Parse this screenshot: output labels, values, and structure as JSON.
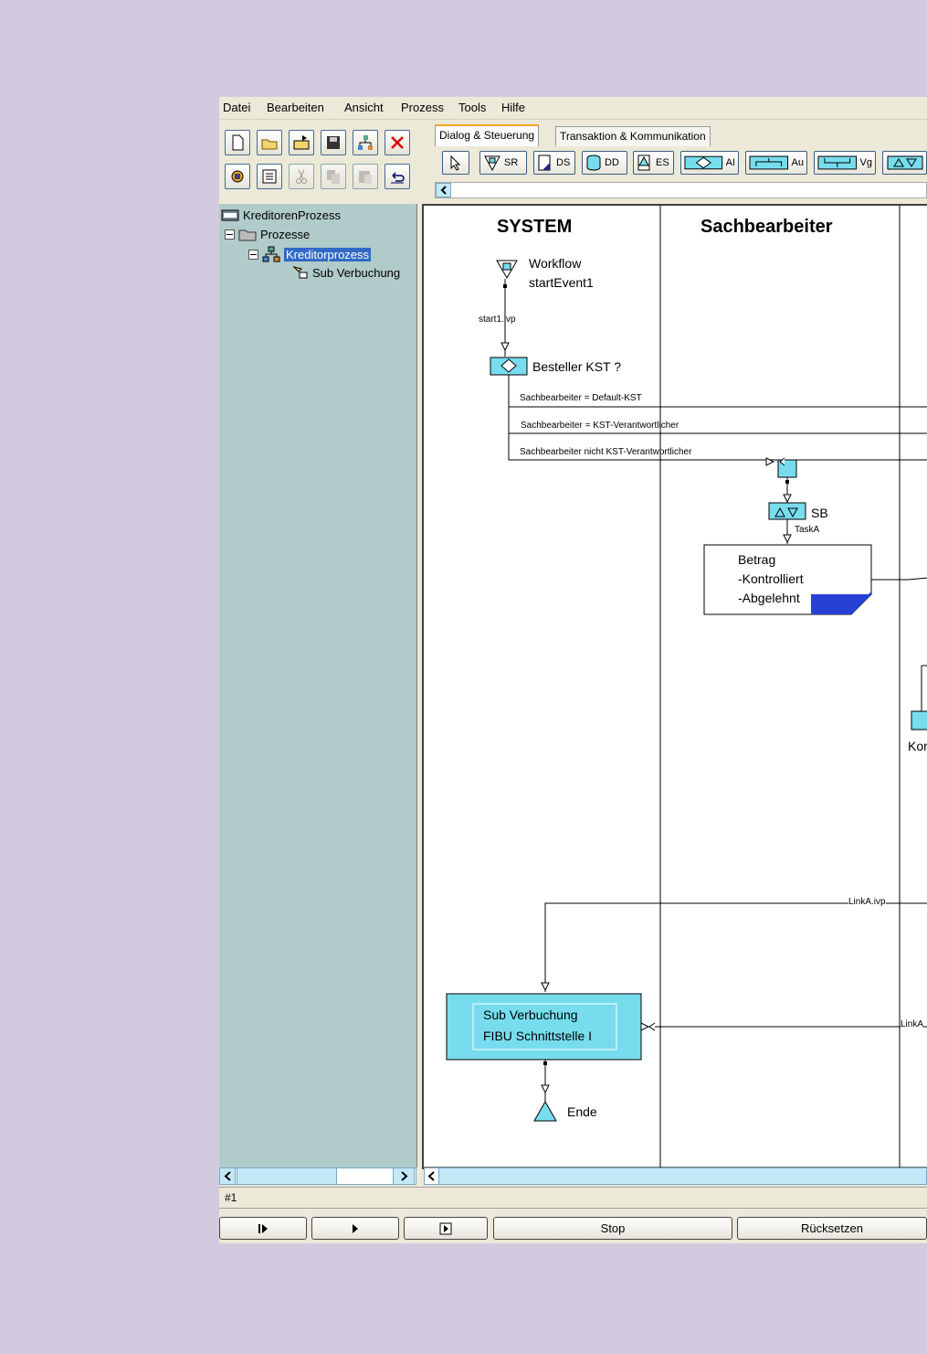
{
  "menu": [
    "Datei",
    "Bearbeiten",
    "Ansicht",
    "Prozess",
    "Tools",
    "Hilfe"
  ],
  "tabs": [
    "Dialog & Steuerung",
    "Transaktion & Kommunikation"
  ],
  "palette": [
    "SR",
    "DS",
    "DD",
    "ES",
    "AI",
    "Au",
    "Vg"
  ],
  "tree": {
    "root": "KreditorenProzess",
    "folder": "Prozesse",
    "process": "Kreditorprozess",
    "sub": "Sub Verbuchung"
  },
  "diagram": {
    "lanes": [
      "SYSTEM",
      "Sachbearbeiter"
    ],
    "start_line1": "Workflow",
    "start_line2": "startEvent1",
    "start_link": "start1.ivp",
    "decision": "Besteller KST ?",
    "cond1": "Sachbearbeiter = Default-KST",
    "cond2": "Sachbearbeiter = KST-Verantwortlicher",
    "cond3": "Sachbearbeiter nicht KST-Verantwortlicher",
    "task_label": "SB",
    "task_sub": "TaskA",
    "note_l1": "Betrag",
    "note_l2": "-Kontrolliert",
    "note_l3": "-Abgelehnt",
    "right_cut": "Kor",
    "link_a": "LinkA.ivp",
    "link_b": "LinkA",
    "sub_l1": "Sub Verbuchung",
    "sub_l2": "FIBU Schnittstelle I",
    "end": "Ende"
  },
  "status": "#1",
  "buttons": {
    "stop": "Stop",
    "reset": "Rücksetzen"
  }
}
